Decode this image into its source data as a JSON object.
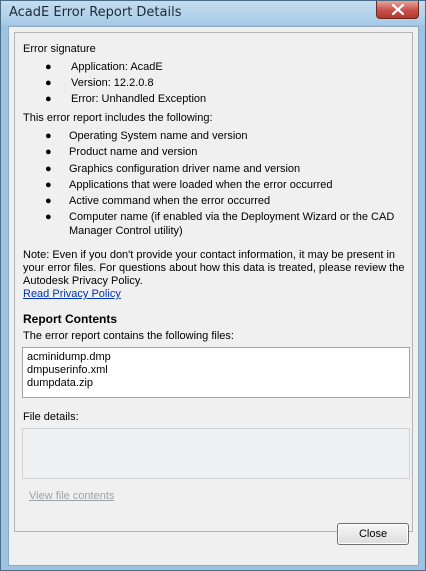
{
  "window": {
    "title": "AcadE Error Report Details"
  },
  "signature": {
    "heading": "Error signature",
    "items": [
      "Application: AcadE",
      "Version: 12.2.0.8",
      "Error: Unhandled Exception"
    ]
  },
  "includes": {
    "heading": "This error report includes the following:",
    "items": [
      "Operating System name and version",
      "Product name and version",
      "Graphics configuration driver name and version",
      "Applications that were loaded when the error occurred",
      "Active command when the error occurred",
      "Computer name (if enabled via the Deployment Wizard or the CAD",
      "Manager Control utility)"
    ]
  },
  "note": {
    "text": "Note: Even if you don't provide your contact information, it may be present in your error files. For questions about how this data is treated, please review the Autodesk Privacy Policy.",
    "privacy_link": "Read Privacy Policy"
  },
  "report": {
    "heading": "Report Contents",
    "files_label": "The error report contains the following files:",
    "files": [
      "acminidump.dmp",
      "dmpuserinfo.xml",
      "dumpdata.zip"
    ],
    "details_label": "File details:",
    "view_link": "View file contents"
  },
  "buttons": {
    "close_label": "Close"
  }
}
